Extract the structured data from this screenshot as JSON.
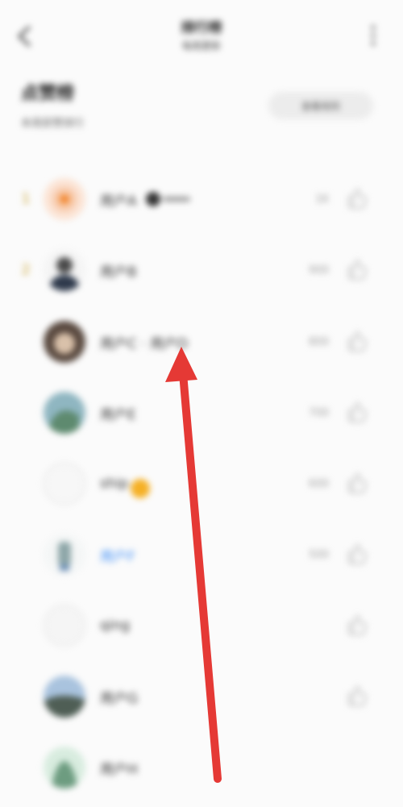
{
  "nav": {
    "title": "排行榜",
    "subtitle": "每周更新"
  },
  "section": {
    "title": "点赞榜",
    "subtitle": "本周获赞排行",
    "button_label": "查看规则"
  },
  "rows": [
    {
      "rank": "1",
      "name": "用户A",
      "stat": "1K",
      "avatar_color": "#f7c8a8"
    },
    {
      "rank": "2",
      "name": "用户B",
      "stat": "900",
      "avatar_color": "#3b4656"
    },
    {
      "rank": "",
      "name": "用户C · 用户D",
      "stat": "800",
      "avatar_color": "#6a5649"
    },
    {
      "rank": "",
      "name": "用户E",
      "stat": "700",
      "avatar_color": "#6f9c8d"
    },
    {
      "rank": "",
      "name": "ship",
      "stat": "600",
      "avatar_color": "#eeeeee"
    },
    {
      "rank": "",
      "name": "用户F",
      "stat": "500",
      "avatar_color": "#8da6a8"
    },
    {
      "rank": "",
      "name": "qing",
      "stat": "",
      "avatar_color": "#f0f0f0"
    },
    {
      "rank": "",
      "name": "用户G",
      "stat": "",
      "avatar_color": "#7f8f9f"
    },
    {
      "rank": "",
      "name": "用户H",
      "stat": "",
      "avatar_color": "#6d9c80"
    }
  ],
  "colors": {
    "accent_gold": "#c9a12c",
    "link_blue": "#3e8ef7",
    "arrow_red": "#e53935"
  }
}
